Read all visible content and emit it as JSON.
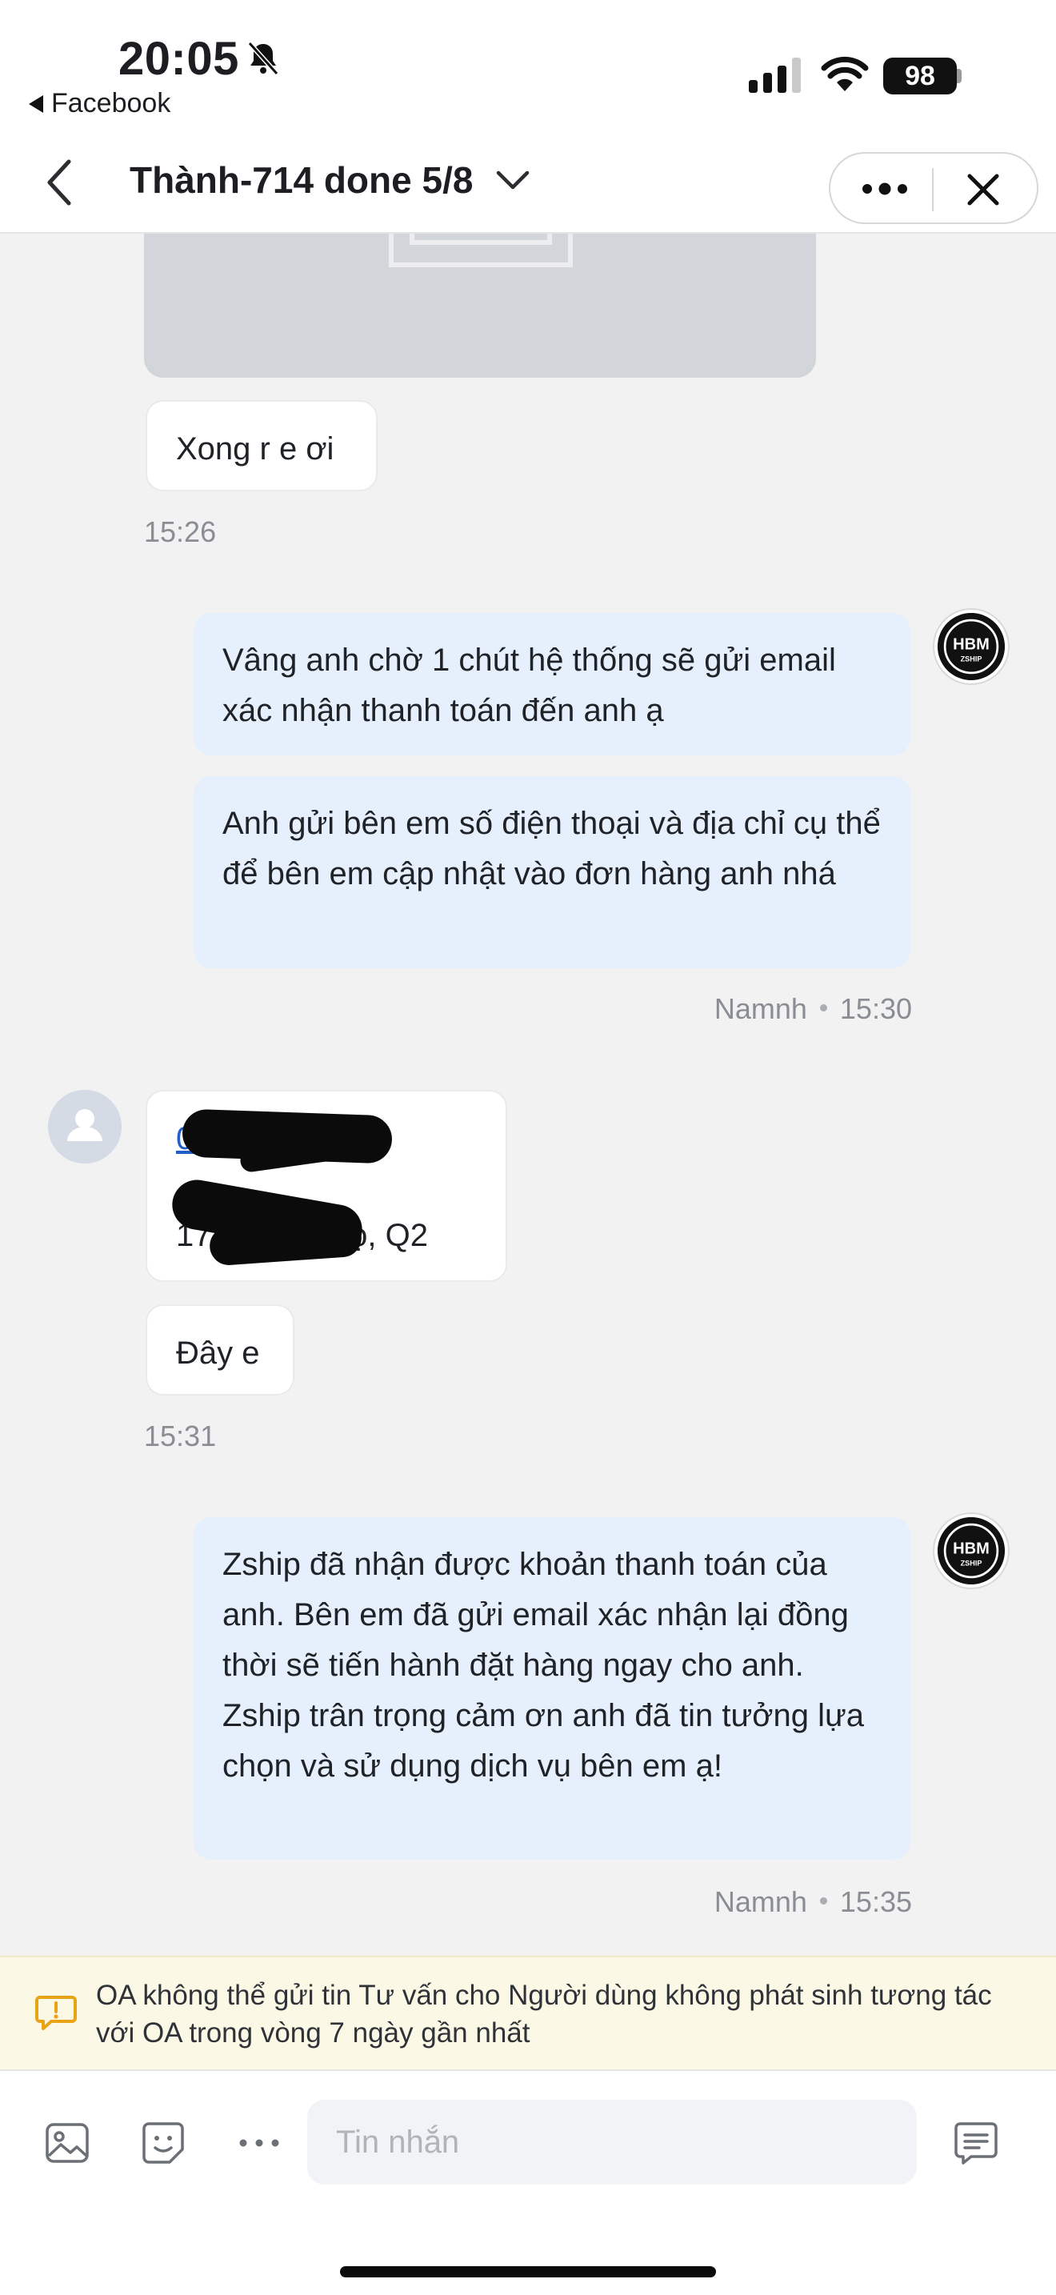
{
  "status_bar": {
    "time": "20:05",
    "back_app_label": "Facebook",
    "battery": "98"
  },
  "header": {
    "title": "Thành-714 done 5/8"
  },
  "messages": {
    "m1_text": "Xong r e ơi",
    "m1_time": "15:26",
    "m2_text": "Vâng anh chờ 1 chút hệ thống sẽ gửi email xác nhận thanh toán đến anh ạ",
    "m3_text": "Anh gửi bên em số điện thoại và địa chỉ cụ thể để bên em cập nhật vào đơn hàng anh nhá",
    "m3_sender": "Namnh",
    "m3_time": "15:30",
    "m4_phone": "0971  .   40",
    "m4_address": "17  M   Chi Thọ, Q2",
    "m5_text": "Đây e",
    "m5_time": "15:31",
    "m6_text": "Zship đã nhận được khoản thanh toán của anh. Bên em đã gửi email xác nhận lại đồng thời sẽ tiến hành đặt hàng ngay cho anh. Zship trân trọng cảm ơn anh đã tin tưởng lựa chọn và sử dụng dịch vụ bên em ạ!",
    "m6_sender": "Namnh",
    "m6_time": "15:35"
  },
  "logo": {
    "top": "HBM",
    "bottom": "ZSHIP"
  },
  "notice": {
    "text": "OA không thể gửi tin Tư vấn cho Người dùng không phát sinh tương tác với OA trong vòng 7 ngày gần nhất"
  },
  "composer": {
    "placeholder": "Tin nhắn"
  },
  "colors": {
    "outgoing_bubble": "#e6f0fd",
    "incoming_bubble": "#ffffff",
    "notice_bg": "#fcf8e6",
    "warning_icon": "#e8a317",
    "link": "#1f5fc6"
  },
  "icons": [
    "bell-slash-icon",
    "signal-icon",
    "wifi-icon",
    "back-icon",
    "chevron-down-icon",
    "more-icon",
    "close-icon",
    "warning-icon",
    "image-icon",
    "sticker-icon",
    "more-options-icon",
    "quick-reply-icon"
  ]
}
